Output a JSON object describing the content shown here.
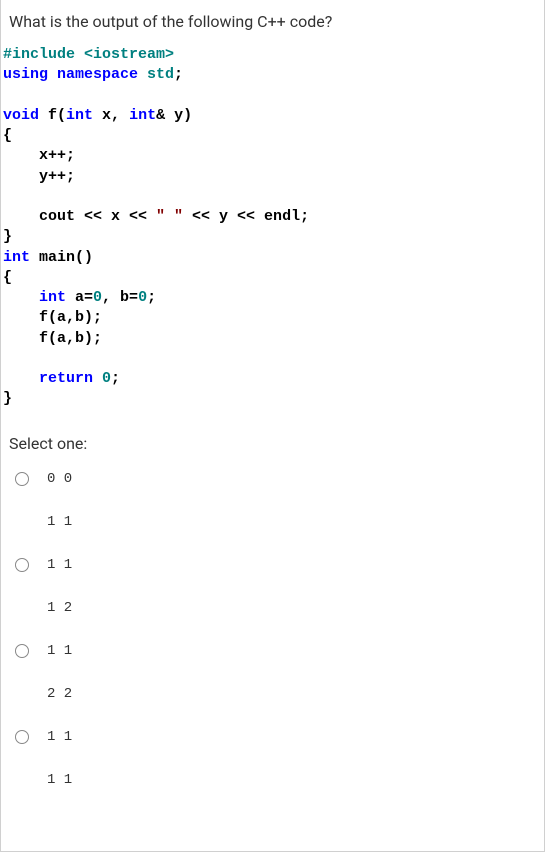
{
  "question": "What is the output of the following C++ code?",
  "code": {
    "line1_pre": "#include ",
    "line1_hdr": "<iostream>",
    "line2_using": "using namespace ",
    "line2_std": "std",
    "line2_semi": ";",
    "line4_void": "void",
    "line4_rest": " f(",
    "line4_int1": "int",
    "line4_x": " x, ",
    "line4_int2": "int",
    "line4_amp": "& y)",
    "line5_brace": "{",
    "line6": "    x++;",
    "line7": "    y++;",
    "line9_cout": "    cout << x << ",
    "line9_str": "\" \"",
    "line9_rest": " << y << endl;",
    "line10_brace": "}",
    "line11_int": "int",
    "line11_main": " main()",
    "line12_brace": "{",
    "line13_int": "    int",
    "line13_a": " a=",
    "line13_0a": "0",
    "line13_b": ", b=",
    "line13_0b": "0",
    "line13_semi": ";",
    "line14": "    f(a,b);",
    "line15": "    f(a,b);",
    "line17_ret": "    return ",
    "line17_0": "0",
    "line17_semi": ";",
    "line18_brace": "}"
  },
  "prompt": "Select one:",
  "options": [
    {
      "line1": "0 0",
      "line2": "1 1"
    },
    {
      "line1": "1 1",
      "line2": "1 2"
    },
    {
      "line1": "1 1",
      "line2": "2 2"
    },
    {
      "line1": "1 1",
      "line2": "1 1"
    }
  ]
}
